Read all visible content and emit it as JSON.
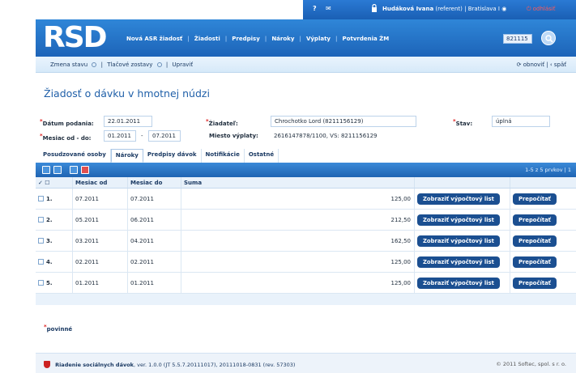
{
  "topbar": {
    "help": "?",
    "mail": "✉",
    "user_name": "Hudáková Ivana",
    "user_role": "(referent)",
    "location": "Bratislava I",
    "logout": "odhlásiť"
  },
  "header": {
    "logo": "RSD",
    "nav": [
      "Nová ASR žiadosť",
      "Žiadosti",
      "Predpisy",
      "Nároky",
      "Výplaty",
      "Potvrdenia ŽM"
    ],
    "search_value": "821115"
  },
  "subnav": {
    "change_status": "Zmena stavu",
    "print": "Tlačové zostavy",
    "edit": "Upraviť",
    "refresh": "obnoviť",
    "back": "späť"
  },
  "page": {
    "title": "Žiadosť o dávku v hmotnej núdzi"
  },
  "form": {
    "date_label": "Dátum podania:",
    "date_value": "22.01.2011",
    "month_label": "Mesiac od - do:",
    "month_from": "01.2011",
    "month_dash": "-",
    "month_to": "07.2011",
    "applicant_label": "Žiadateľ:",
    "applicant_value": "Chrochotko Lord (8211156129)",
    "payment_label": "Miesto výplaty:",
    "payment_value": "2616147878/1100, VS: 8211156129",
    "status_label": "Stav:",
    "status_value": "úplná"
  },
  "tabs": [
    "Posudzované osoby",
    "Nároky",
    "Predpisy dávok",
    "Notifikácie",
    "Ostatné"
  ],
  "grid": {
    "pager": "1-5 z 5 prvkov | 1",
    "columns": [
      "",
      "Mesiac od",
      "Mesiac do",
      "Suma",
      "",
      ""
    ],
    "check_all": "✓ ☐",
    "rows": [
      {
        "n": "1.",
        "from": "07.2011",
        "to": "07.2011",
        "sum": "125,00"
      },
      {
        "n": "2.",
        "from": "05.2011",
        "to": "06.2011",
        "sum": "212,50"
      },
      {
        "n": "3.",
        "from": "03.2011",
        "to": "04.2011",
        "sum": "162,50"
      },
      {
        "n": "4.",
        "from": "02.2011",
        "to": "02.2011",
        "sum": "125,00"
      },
      {
        "n": "5.",
        "from": "01.2011",
        "to": "01.2011",
        "sum": "125,00"
      }
    ],
    "show_btn": "Zobraziť výpočtový list",
    "recalc_btn": "Prepočítať"
  },
  "required": "povinné",
  "footer": {
    "app": "Riadenie sociálnych dávok",
    "version": ", ver. 1.0.0 (JT 5.5.7.20111017), 20111018-0831 (rev. 57303)",
    "copyright": "© 2011 Softec, spol. s r. o."
  }
}
